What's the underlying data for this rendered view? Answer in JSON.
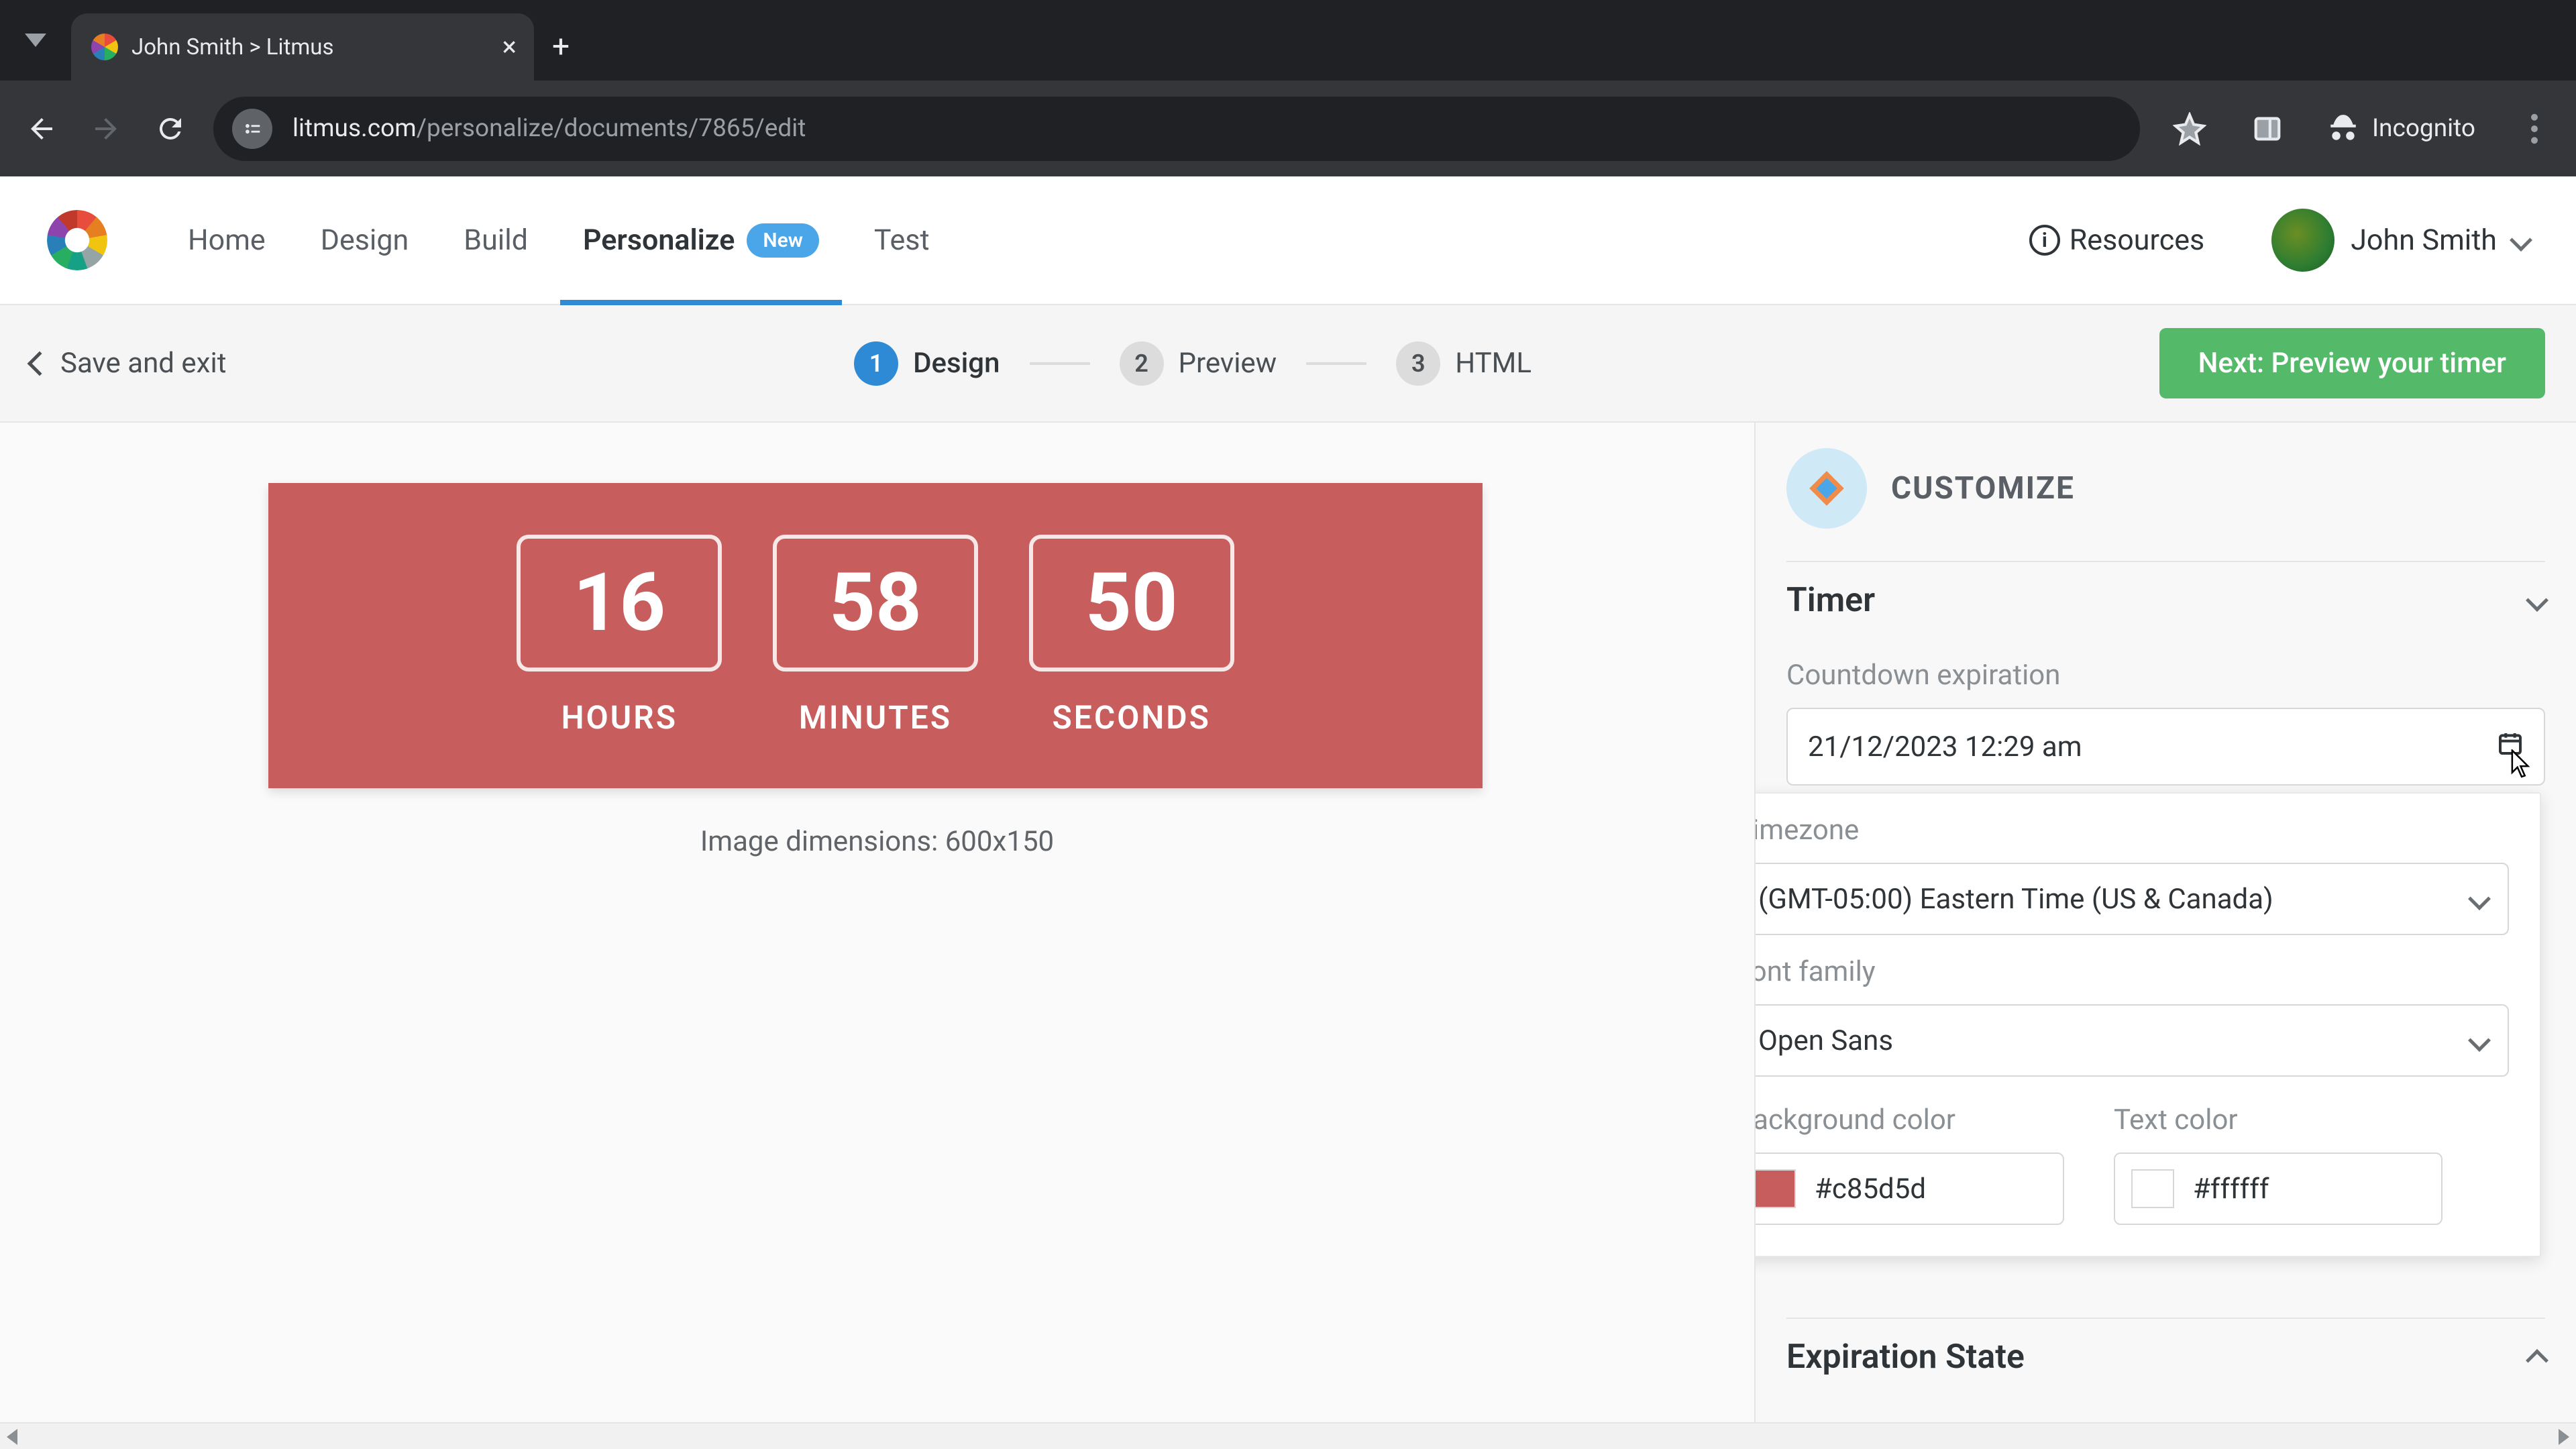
{
  "browser": {
    "tab_title": "John Smith > Litmus",
    "url_domain": "litmus.com",
    "url_path": "/personalize/documents/7865/edit",
    "incognito_label": "Incognito"
  },
  "nav": {
    "items": [
      "Home",
      "Design",
      "Build",
      "Personalize",
      "Test"
    ],
    "badge_new": "New",
    "resources": "Resources",
    "user_name": "John Smith"
  },
  "subbar": {
    "save_exit": "Save and exit",
    "steps": [
      {
        "num": "1",
        "label": "Design"
      },
      {
        "num": "2",
        "label": "Preview"
      },
      {
        "num": "3",
        "label": "HTML"
      }
    ],
    "next_button": "Next: Preview your timer"
  },
  "timer_preview": {
    "units": [
      {
        "value": "16",
        "label": "HOURS"
      },
      {
        "value": "58",
        "label": "MINUTES"
      },
      {
        "value": "50",
        "label": "SECONDS"
      }
    ],
    "dimensions": "Image dimensions: 600x150",
    "bg_color": "#c85d5d"
  },
  "customize": {
    "title": "CUSTOMIZE",
    "section_timer": "Timer",
    "countdown_label": "Countdown expiration",
    "countdown_value": "21/12/2023  12:29  am",
    "timezone_label": "Timezone",
    "timezone_value": "(GMT-05:00) Eastern Time (US & Canada)",
    "font_label": "Font family",
    "font_value": "Open Sans",
    "bgcolor_label": "Background color",
    "bgcolor_value": "#c85d5d",
    "textcolor_label": "Text color",
    "textcolor_value": "#ffffff",
    "section_expiration": "Expiration State"
  }
}
